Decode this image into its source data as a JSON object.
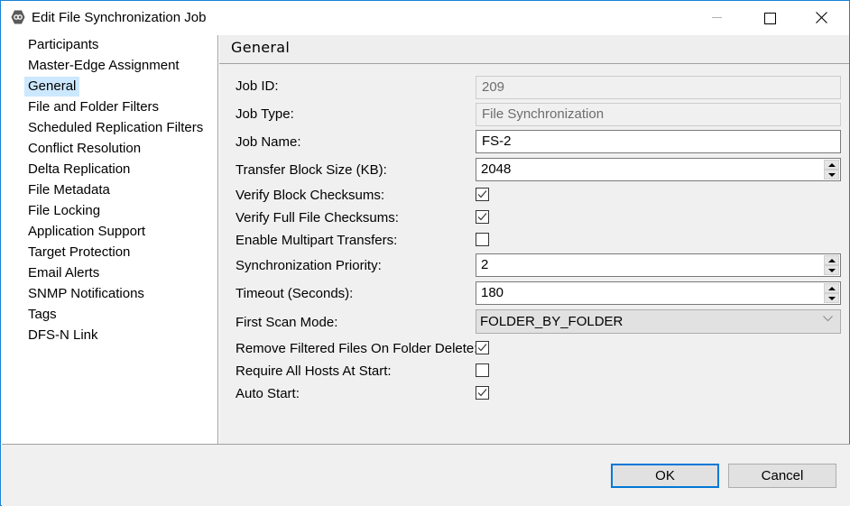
{
  "window": {
    "title": "Edit File Synchronization Job",
    "app_icon": "peer-app-icon",
    "controls": [
      "minimize",
      "maximize",
      "close"
    ]
  },
  "sidebar": {
    "selected_index": 2,
    "items": [
      {
        "label": "Participants"
      },
      {
        "label": "Master-Edge Assignment"
      },
      {
        "label": "General"
      },
      {
        "label": "File and Folder Filters"
      },
      {
        "label": "Scheduled Replication Filters"
      },
      {
        "label": "Conflict Resolution"
      },
      {
        "label": "Delta Replication"
      },
      {
        "label": "File Metadata"
      },
      {
        "label": "File Locking"
      },
      {
        "label": "Application Support"
      },
      {
        "label": "Target Protection"
      },
      {
        "label": "Email Alerts"
      },
      {
        "label": "SNMP Notifications"
      },
      {
        "label": "Tags"
      },
      {
        "label": "DFS-N Link"
      }
    ]
  },
  "content": {
    "title": "General",
    "fields": {
      "job_id": {
        "label": "Job ID:",
        "value": "209",
        "enabled": false
      },
      "job_type": {
        "label": "Job Type:",
        "value": "File Synchronization",
        "enabled": false
      },
      "job_name": {
        "label": "Job Name:",
        "value": "FS-2"
      },
      "transfer_block_size": {
        "label": "Transfer Block Size (KB):",
        "value": "2048"
      },
      "verify_block_checksums": {
        "label": "Verify Block Checksums:",
        "checked": true
      },
      "verify_full_file_checksums": {
        "label": "Verify Full File Checksums:",
        "checked": true
      },
      "enable_multipart_transfers": {
        "label": "Enable Multipart Transfers:",
        "checked": false
      },
      "synchronization_priority": {
        "label": "Synchronization Priority:",
        "value": "2"
      },
      "timeout_seconds": {
        "label": "Timeout (Seconds):",
        "value": "180"
      },
      "first_scan_mode": {
        "label": "First Scan Mode:",
        "value": "FOLDER_BY_FOLDER"
      },
      "remove_filtered_files": {
        "label": "Remove Filtered Files On Folder Delete:",
        "checked": true
      },
      "require_all_hosts": {
        "label": "Require All Hosts At Start:",
        "checked": false
      },
      "auto_start": {
        "label": "Auto Start:",
        "checked": true
      }
    }
  },
  "footer": {
    "ok_label": "OK",
    "cancel_label": "Cancel"
  }
}
